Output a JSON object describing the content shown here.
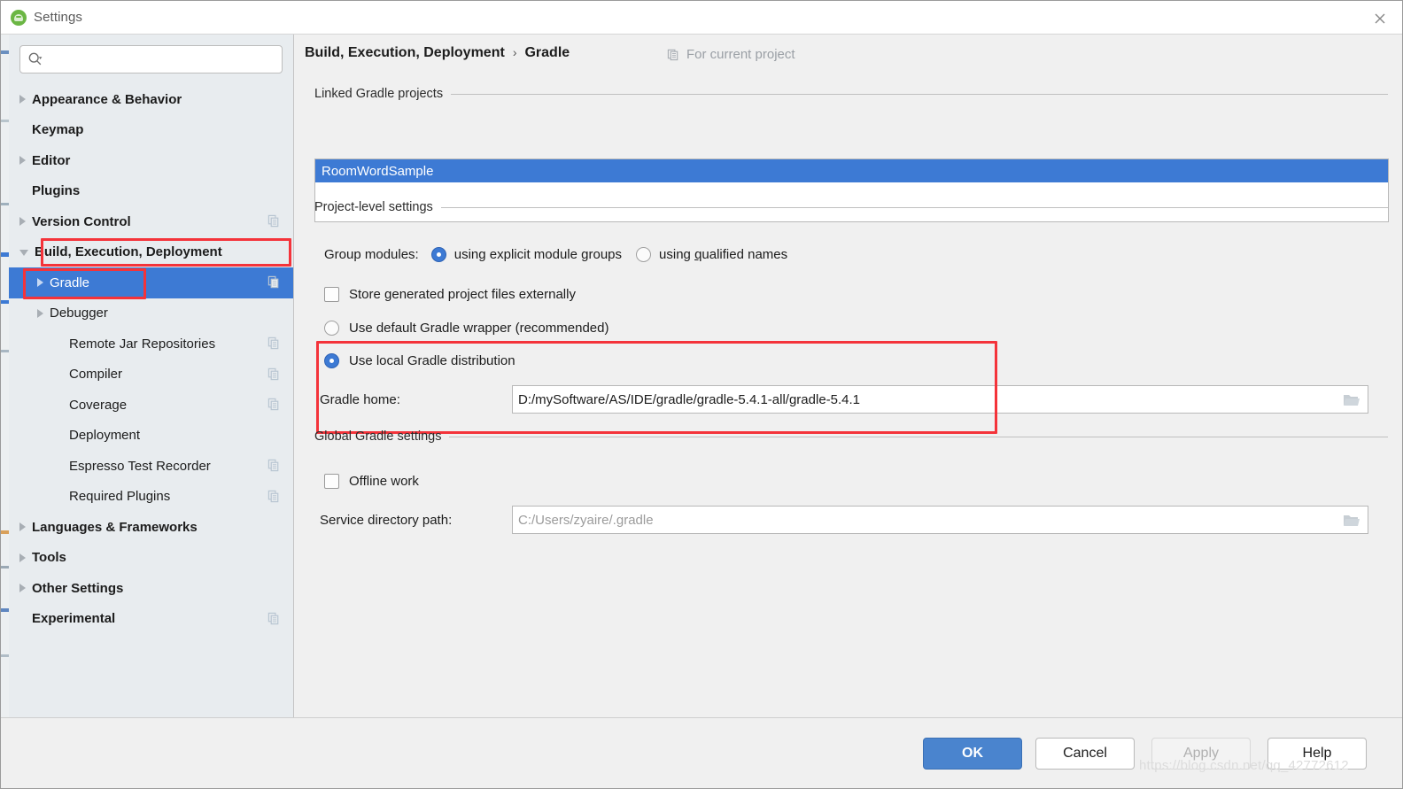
{
  "window": {
    "title": "Settings",
    "app_icon": "android-studio-icon",
    "close_icon": "close-icon"
  },
  "sidebar": {
    "search": {
      "placeholder": "",
      "value": "",
      "icon": "search-icon"
    },
    "items": [
      {
        "label": "Appearance & Behavior",
        "indent": 0,
        "arrow": "right",
        "bold": true,
        "selected": false,
        "copy_icon": false
      },
      {
        "label": "Keymap",
        "indent": 0,
        "arrow": "none",
        "bold": true,
        "selected": false,
        "copy_icon": false
      },
      {
        "label": "Editor",
        "indent": 0,
        "arrow": "right",
        "bold": true,
        "selected": false,
        "copy_icon": false
      },
      {
        "label": "Plugins",
        "indent": 0,
        "arrow": "none",
        "bold": true,
        "selected": false,
        "copy_icon": false
      },
      {
        "label": "Version Control",
        "indent": 0,
        "arrow": "right",
        "bold": true,
        "selected": false,
        "copy_icon": true
      },
      {
        "label": "Build, Execution, Deployment",
        "indent": 0,
        "arrow": "down",
        "bold": true,
        "selected": false,
        "copy_icon": false
      },
      {
        "label": "Gradle",
        "indent": 1,
        "arrow": "right",
        "bold": false,
        "selected": true,
        "copy_icon": true
      },
      {
        "label": "Debugger",
        "indent": 1,
        "arrow": "right",
        "bold": false,
        "selected": false,
        "copy_icon": false
      },
      {
        "label": "Remote Jar Repositories",
        "indent": 2,
        "arrow": "none",
        "bold": false,
        "selected": false,
        "copy_icon": true
      },
      {
        "label": "Compiler",
        "indent": 2,
        "arrow": "none",
        "bold": false,
        "selected": false,
        "copy_icon": true
      },
      {
        "label": "Coverage",
        "indent": 2,
        "arrow": "none",
        "bold": false,
        "selected": false,
        "copy_icon": true
      },
      {
        "label": "Deployment",
        "indent": 2,
        "arrow": "none",
        "bold": false,
        "selected": false,
        "copy_icon": false
      },
      {
        "label": "Espresso Test Recorder",
        "indent": 2,
        "arrow": "none",
        "bold": false,
        "selected": false,
        "copy_icon": true
      },
      {
        "label": "Required Plugins",
        "indent": 2,
        "arrow": "none",
        "bold": false,
        "selected": false,
        "copy_icon": true
      },
      {
        "label": "Languages & Frameworks",
        "indent": 0,
        "arrow": "right",
        "bold": true,
        "selected": false,
        "copy_icon": false
      },
      {
        "label": "Tools",
        "indent": 0,
        "arrow": "right",
        "bold": true,
        "selected": false,
        "copy_icon": false
      },
      {
        "label": "Other Settings",
        "indent": 0,
        "arrow": "right",
        "bold": true,
        "selected": false,
        "copy_icon": false
      },
      {
        "label": "Experimental",
        "indent": 0,
        "arrow": "none",
        "bold": true,
        "selected": false,
        "copy_icon": true
      }
    ]
  },
  "main": {
    "breadcrumb_parent": "Build, Execution, Deployment",
    "breadcrumb_sep": "›",
    "breadcrumb_current": "Gradle",
    "for_current_project": "For current project",
    "for_current_project_icon": "project-scope-icon",
    "sections": {
      "linked": "Linked Gradle projects",
      "project_level": "Project-level settings",
      "global": "Global Gradle settings"
    },
    "linked_projects": [
      {
        "name": "RoomWordSample",
        "selected": true
      }
    ],
    "group_modules": {
      "label": "Group modules:",
      "options": [
        {
          "label_pre": "using explicit module ",
          "mnemonic": "g",
          "label_post": "roups",
          "selected": true
        },
        {
          "label_pre": "using ",
          "mnemonic": "q",
          "label_post": "ualified names",
          "selected": false
        }
      ]
    },
    "store_externally": {
      "label": "Store generated project files externally",
      "checked": false
    },
    "gradle_source": {
      "options": [
        {
          "label": "Use default Gradle wrapper (recommended)",
          "selected": false
        },
        {
          "label": "Use local Gradle distribution",
          "selected": true
        }
      ]
    },
    "gradle_home": {
      "label": "Gradle home:",
      "value": "D:/mySoftware/AS/IDE/gradle/gradle-5.4.1-all/gradle-5.4.1",
      "browse_icon": "folder-icon"
    },
    "offline_work": {
      "label": "Offline work",
      "checked": false
    },
    "service_dir": {
      "label": "Service directory path:",
      "placeholder": "C:/Users/zyaire/.gradle",
      "value": "",
      "browse_icon": "folder-icon"
    }
  },
  "footer": {
    "ok": "OK",
    "cancel": "Cancel",
    "apply": "Apply",
    "help": "Help"
  },
  "watermark": "https://blog.csdn.net/qq_42772612",
  "colors": {
    "accent": "#3d7ad4",
    "primary_button": "#4a84ce",
    "highlight_box": "#f4333a",
    "sidebar_bg": "#e8ecef",
    "panel_bg": "#f0f0f0"
  }
}
